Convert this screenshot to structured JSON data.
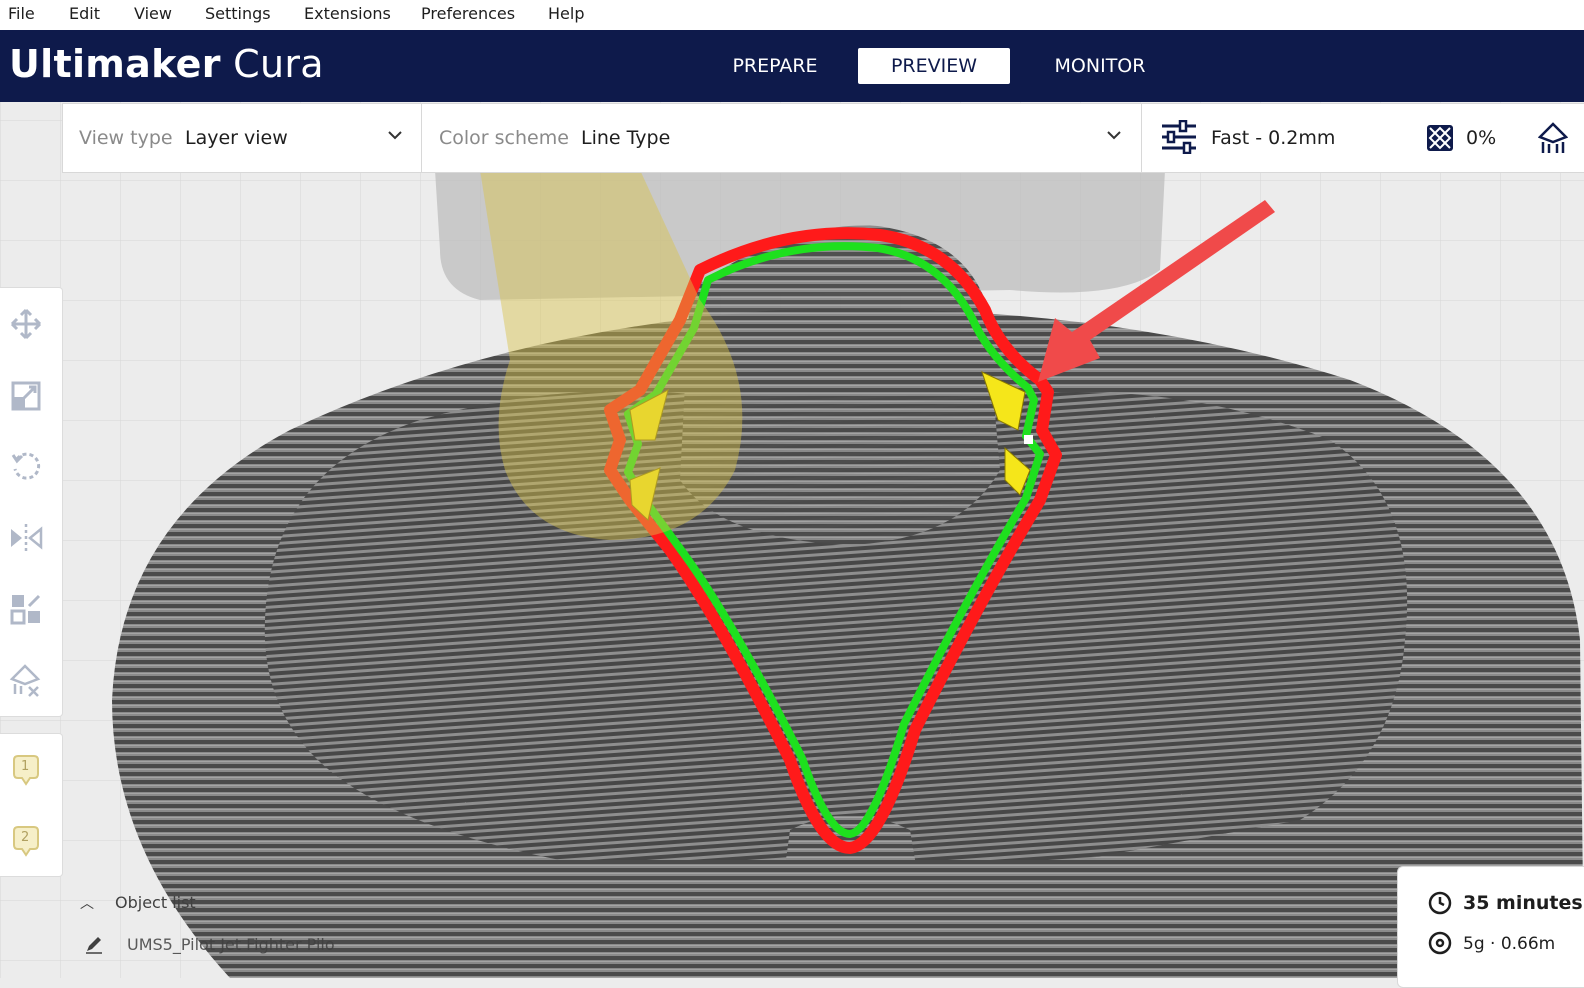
{
  "menu": [
    "File",
    "Edit",
    "View",
    "Settings",
    "Extensions",
    "Preferences",
    "Help"
  ],
  "brand": {
    "bold": "Ultimaker",
    "light": "Cura"
  },
  "stages": [
    {
      "label": "PREPARE",
      "active": false
    },
    {
      "label": "PREVIEW",
      "active": true
    },
    {
      "label": "MONITOR",
      "active": false
    }
  ],
  "viewbar": {
    "view_type_label": "View type",
    "view_type_value": "Layer view",
    "color_scheme_label": "Color scheme",
    "color_scheme_value": "Line Type"
  },
  "print_setup": {
    "profile": "Fast - 0.2mm",
    "infill": "0%"
  },
  "toolbar": {
    "tools": [
      "move-icon",
      "scale-icon",
      "rotate-icon",
      "mirror-icon",
      "per-model-settings-icon",
      "support-blocker-icon"
    ],
    "extruders": [
      "1",
      "2"
    ]
  },
  "object_list": {
    "label": "Object list",
    "item": "UMS5_Pilot Jet Fighter Pilo"
  },
  "estimate": {
    "time": "35 minutes",
    "material": "5g · 0.66m"
  },
  "colors": {
    "header_bg": "#0e1a4b",
    "wall_outer": "#ff1a1a",
    "wall_inner": "#1ee01e",
    "infill": "#f5e61a",
    "model_gray": "#5a5a5a",
    "arrow": "#f04a4a"
  }
}
